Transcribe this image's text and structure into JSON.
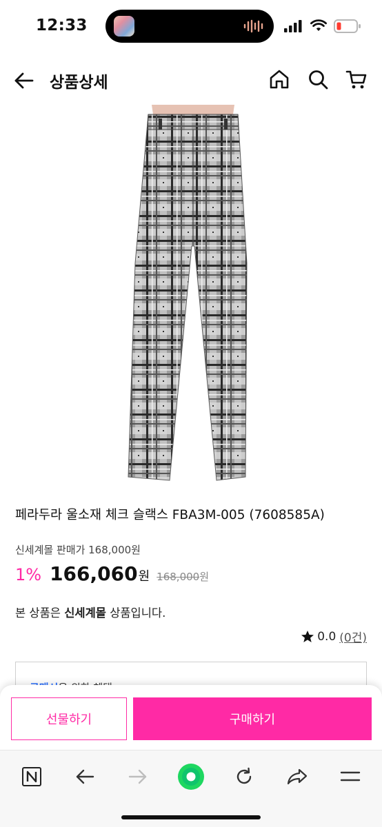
{
  "status_bar": {
    "time": "12:33",
    "battery_color": "#ff3b30"
  },
  "header": {
    "title": "상품상세",
    "icons": [
      "back-arrow-icon",
      "home-icon",
      "search-icon",
      "cart-icon"
    ]
  },
  "product": {
    "image": "gray-glen-check-slacks",
    "name": "페라두라 울소재 체크 슬랙스 FBA3M-005 (7608585A)",
    "seller_price": "신세계몰 판매가 168,000원",
    "discount": "1%",
    "sale_price": "166,060",
    "sale_currency": "원",
    "original_price": "168,000",
    "original_currency": "원",
    "notice_prefix": "본 상품은 ",
    "notice_mall": "신세계몰",
    "notice_suffix": " 상품입니다.",
    "rating": "0.0",
    "review_count": "(0건)",
    "benefit_link": "구매시",
    "benefit_rest": "을 위한 혜택"
  },
  "actions": {
    "gift_label": "선물하기",
    "buy_label": "구매하기"
  },
  "colors": {
    "accent": "#ff2aa5",
    "text": "#111111"
  },
  "browser_toolbar": {
    "items": [
      "naver-n-icon",
      "back-icon",
      "forward-icon",
      "green-dot-icon",
      "reload-icon",
      "share-icon",
      "menu-icon"
    ]
  }
}
